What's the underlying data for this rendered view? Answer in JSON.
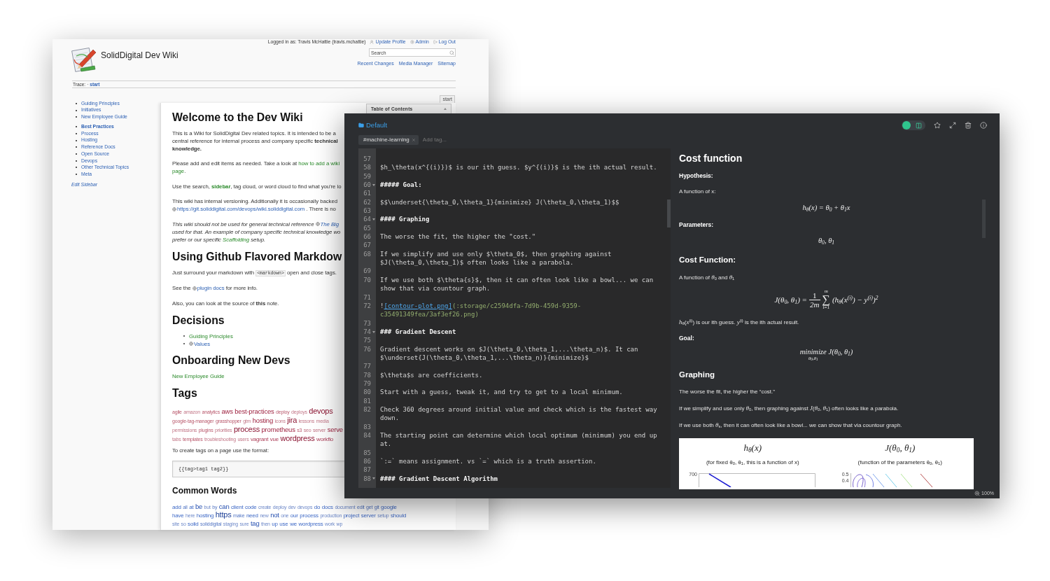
{
  "wiki": {
    "user_bar": {
      "text": "Logged in as: Travis McHattie (travis.mchattie)",
      "links": [
        {
          "kind": "profile",
          "label": "Update Profile"
        },
        {
          "kind": "admin",
          "label": "Admin"
        },
        {
          "kind": "logout",
          "label": "Log Out"
        }
      ]
    },
    "site_title": "SolidDigital Dev Wiki",
    "search": {
      "placeholder": "Search"
    },
    "nav_links": [
      "Recent Changes",
      "Media Manager",
      "Sitemap"
    ],
    "trace": {
      "label": "Trace:",
      "separator": "·",
      "page": "start"
    },
    "sidebar": {
      "groups": [
        [
          {
            "label": "Guiding Principles",
            "bold": false
          },
          {
            "label": "Initiatives",
            "bold": false
          },
          {
            "label": "New Employee Guide",
            "bold": false
          }
        ],
        [
          {
            "label": "Best Practices",
            "bold": true
          },
          {
            "label": "Process",
            "bold": false
          },
          {
            "label": "Hosting",
            "bold": false
          },
          {
            "label": "Reference Docs",
            "bold": false
          },
          {
            "label": "Open Source",
            "bold": false
          },
          {
            "label": "Devops",
            "bold": false
          },
          {
            "label": "Other Technical Topics",
            "bold": false
          },
          {
            "label": "Meta",
            "bold": false
          }
        ]
      ],
      "edit_link": "Edit Sidebar"
    },
    "page_tab": "start",
    "toc_title": "Table of Contents",
    "content": [
      {
        "kind": "h1",
        "text": "Welcome to the Dev Wiki"
      },
      {
        "kind": "paragraph",
        "lines": [
          [
            {
              "kind": "text",
              "text": "This is a Wiki for SolidDigital Dev related topics. It is intended to be a"
            }
          ],
          [
            {
              "kind": "text",
              "text": "central reference for internal process and company specific **technical**"
            }
          ],
          [
            {
              "kind": "text",
              "text": "**knowledge.**"
            }
          ]
        ]
      },
      {
        "kind": "paragraph",
        "lines": [
          [
            {
              "kind": "text",
              "text": "Please add and edit items as needed. Take a look at "
            },
            {
              "kind": "link",
              "text": "how to add a wiki"
            }
          ],
          [
            {
              "kind": "link",
              "text": "page"
            },
            {
              "kind": "text",
              "text": "."
            }
          ]
        ]
      },
      {
        "kind": "paragraph",
        "lines": [
          [
            {
              "kind": "text",
              "text": "Use the search, "
            },
            {
              "kind": "bold-link",
              "text": "sidebar"
            },
            {
              "kind": "text",
              "text": ", tag cloud, or word cloud to find what you're lo"
            }
          ]
        ]
      },
      {
        "kind": "paragraph",
        "lines": [
          [
            {
              "kind": "text",
              "text": "This wiki has internal versioning. Additionally it is occasionally backed"
            }
          ],
          [
            {
              "kind": "url",
              "text": "https://git.soliddigital.com/devops/wiki.soliddigital.com"
            },
            {
              "kind": "text",
              "text": " . There is no"
            }
          ]
        ]
      },
      {
        "kind": "note",
        "lines": [
          [
            {
              "kind": "text",
              "text": "This wiki should not be used for general technical reference "
            },
            {
              "kind": "url",
              "text": "The Big"
            }
          ],
          [
            {
              "kind": "text",
              "text": "used for that. An example of company specific technical knowledge wo"
            }
          ],
          [
            {
              "kind": "text",
              "text": "prefer or our specific "
            },
            {
              "kind": "link",
              "text": "Scaffolding"
            },
            {
              "kind": "text",
              "text": " setup."
            }
          ]
        ]
      },
      {
        "kind": "h2",
        "text": "Using Github Flavored Markdow"
      },
      {
        "kind": "paragraph",
        "lines": [
          [
            {
              "kind": "text",
              "text": "Just surround your markdown with "
            },
            {
              "kind": "code",
              "text": "<markdown>"
            },
            {
              "kind": "text",
              "text": " open and close tags."
            }
          ]
        ]
      },
      {
        "kind": "paragraph",
        "lines": [
          [
            {
              "kind": "text",
              "text": "See the "
            },
            {
              "kind": "url",
              "text": "plugin docs"
            },
            {
              "kind": "text",
              "text": " for more info."
            }
          ]
        ]
      },
      {
        "kind": "paragraph",
        "lines": [
          [
            {
              "kind": "text",
              "text": "Also, you can look at the source of **this** note."
            }
          ]
        ]
      },
      {
        "kind": "h2",
        "text": "Decisions"
      },
      {
        "kind": "list",
        "items": [
          [
            {
              "kind": "link",
              "text": "Guiding Principles"
            }
          ],
          [
            {
              "kind": "url",
              "text": "Values"
            }
          ]
        ]
      },
      {
        "kind": "h2",
        "text": "Onboarding New Devs"
      },
      {
        "kind": "paragraph",
        "lines": [
          [
            {
              "kind": "link",
              "text": "New Employee Guide"
            }
          ]
        ]
      },
      {
        "kind": "h2",
        "text": "Tags"
      },
      {
        "kind": "tag_cloud",
        "lines": [
          {
            "tags": [
              {
                "text": "agile",
                "kind": "uncommon"
              },
              {
                "text": "amazon",
                "kind": "rare"
              },
              {
                "text": "analytics",
                "kind": "uncommon"
              },
              {
                "text": "aws",
                "kind": "frequent"
              },
              {
                "text": "best-practices",
                "kind": "frequent"
              },
              {
                "text": "deploy",
                "kind": "uncommon"
              },
              {
                "text": "deploys",
                "kind": "rare"
              },
              {
                "text": "devops",
                "kind": "top"
              }
            ]
          },
          {
            "tags": [
              {
                "text": "google-tag-manager",
                "kind": "uncommon"
              },
              {
                "text": "grasshopper",
                "kind": "uncommon"
              },
              {
                "text": "gtm",
                "kind": "rare"
              },
              {
                "text": "hosting",
                "kind": "frequent"
              },
              {
                "text": "icons",
                "kind": "rare"
              },
              {
                "text": "jira",
                "kind": "top"
              },
              {
                "text": "lessons",
                "kind": "rare"
              },
              {
                "text": "media",
                "kind": "rare"
              }
            ]
          },
          {
            "tags": [
              {
                "text": "permissions",
                "kind": "rare"
              },
              {
                "text": "plugins",
                "kind": "uncommon"
              },
              {
                "text": "priorities",
                "kind": "rare"
              },
              {
                "text": "process",
                "kind": "top"
              },
              {
                "text": "prometheus",
                "kind": "frequent"
              },
              {
                "text": "s3",
                "kind": "uncommon"
              },
              {
                "text": "seo",
                "kind": "rare"
              },
              {
                "text": "server",
                "kind": "rare"
              },
              {
                "text": "serve",
                "kind": "frequent"
              }
            ]
          },
          {
            "tags": [
              {
                "text": "tabs",
                "kind": "rare"
              },
              {
                "text": "templates",
                "kind": "uncommon"
              },
              {
                "text": "troubleshooting",
                "kind": "rare"
              },
              {
                "text": "users",
                "kind": "rare"
              },
              {
                "text": "vagrant",
                "kind": "common"
              },
              {
                "text": "vue",
                "kind": "common"
              },
              {
                "text": "wordpress",
                "kind": "top"
              },
              {
                "text": "workflo",
                "kind": "common"
              }
            ]
          }
        ]
      },
      {
        "kind": "paragraph",
        "lines": [
          [
            {
              "kind": "text",
              "text": "To create tags on a page use the format:"
            }
          ]
        ]
      },
      {
        "kind": "code_block",
        "text": "{{tag>tag1 tag2}}"
      },
      {
        "kind": "h3",
        "text": "Common Words"
      },
      {
        "kind": "word_cloud",
        "lines": [
          {
            "tags": [
              {
                "text": "add",
                "kind": "common"
              },
              {
                "text": "all",
                "kind": "uncommon"
              },
              {
                "text": "at",
                "kind": "common"
              },
              {
                "text": "be",
                "kind": "frequent"
              },
              {
                "text": "but",
                "kind": "rare"
              },
              {
                "text": "by",
                "kind": "uncommon"
              },
              {
                "text": "can",
                "kind": "frequent"
              },
              {
                "text": "client",
                "kind": "common"
              },
              {
                "text": "code",
                "kind": "common"
              },
              {
                "text": "create",
                "kind": "rare"
              },
              {
                "text": "deploy",
                "kind": "rare"
              },
              {
                "text": "dev",
                "kind": "rare"
              },
              {
                "text": "devops",
                "kind": "rare"
              },
              {
                "text": "do",
                "kind": "common"
              },
              {
                "text": "docs",
                "kind": "common"
              },
              {
                "text": "document",
                "kind": "rare"
              },
              {
                "text": "edit",
                "kind": "uncommon"
              },
              {
                "text": "get",
                "kind": "uncommon"
              },
              {
                "text": "git",
                "kind": "uncommon"
              },
              {
                "text": "google",
                "kind": "common"
              }
            ]
          },
          {
            "tags": [
              {
                "text": "have",
                "kind": "common"
              },
              {
                "text": "here",
                "kind": "rare"
              },
              {
                "text": "hosting",
                "kind": "common"
              },
              {
                "text": "https",
                "kind": "top"
              },
              {
                "text": "make",
                "kind": "uncommon"
              },
              {
                "text": "need",
                "kind": "common"
              },
              {
                "text": "new",
                "kind": "rare"
              },
              {
                "text": "not",
                "kind": "frequent"
              },
              {
                "text": "one",
                "kind": "rare"
              },
              {
                "text": "our",
                "kind": "common"
              },
              {
                "text": "process",
                "kind": "common"
              },
              {
                "text": "production",
                "kind": "rare"
              },
              {
                "text": "project",
                "kind": "common"
              },
              {
                "text": "server",
                "kind": "common"
              },
              {
                "text": "setup",
                "kind": "rare"
              },
              {
                "text": "should",
                "kind": "common"
              }
            ]
          },
          {
            "tags": [
              {
                "text": "site",
                "kind": "rare"
              },
              {
                "text": "so",
                "kind": "rare"
              },
              {
                "text": "solid",
                "kind": "common"
              },
              {
                "text": "soliddigital",
                "kind": "uncommon"
              },
              {
                "text": "staging",
                "kind": "rare"
              },
              {
                "text": "sure",
                "kind": "rare"
              },
              {
                "text": "tag",
                "kind": "frequent"
              },
              {
                "text": "then",
                "kind": "rare"
              },
              {
                "text": "up",
                "kind": "common"
              },
              {
                "text": "use",
                "kind": "common"
              },
              {
                "text": "we",
                "kind": "common"
              },
              {
                "text": "wordpress",
                "kind": "common"
              },
              {
                "text": "work",
                "kind": "rare"
              },
              {
                "text": "wp",
                "kind": "rare"
              }
            ]
          }
        ]
      }
    ]
  },
  "editor": {
    "folder": "Default",
    "tags": [
      "#machine-learning"
    ],
    "tag_input": {
      "placeholder": "Add tag..."
    },
    "mode_toggle": {
      "on": false
    },
    "lines": [
      {
        "number": "57",
        "foldable": false
      },
      {
        "number": "58",
        "foldable": false,
        "segments": [
          {
            "kind": "plain",
            "text": "$h_\\theta(x^{(i)})$ is our ith guess. $y^{(i)}$ is the ith actual result."
          }
        ]
      },
      {
        "number": "59",
        "foldable": false
      },
      {
        "number": "60",
        "foldable": true,
        "segments": [
          {
            "kind": "heading",
            "text": "##### Goal:"
          }
        ]
      },
      {
        "number": "61",
        "foldable": false
      },
      {
        "number": "62",
        "foldable": false,
        "segments": [
          {
            "kind": "plain",
            "text": "$$\\underset{\\theta_0,\\theta_1}{minimize} J(\\theta_0,\\theta_1)$$"
          }
        ]
      },
      {
        "number": "63",
        "foldable": false
      },
      {
        "number": "64",
        "foldable": true,
        "segments": [
          {
            "kind": "heading",
            "text": "#### Graphing"
          }
        ]
      },
      {
        "number": "65",
        "foldable": false
      },
      {
        "number": "66",
        "foldable": false,
        "segments": [
          {
            "kind": "plain",
            "text": "The worse the fit, the higher the \"cost.\""
          }
        ]
      },
      {
        "number": "67",
        "foldable": false
      },
      {
        "number": "68",
        "foldable": false,
        "segments": [
          {
            "kind": "plain",
            "text": "If we simplify and use only $\\theta_0$, then graphing against $J(\\theta_0,\\theta_1)$ often looks like a parabola."
          }
        ]
      },
      {
        "number": "69",
        "foldable": false
      },
      {
        "number": "70",
        "foldable": false,
        "segments": [
          {
            "kind": "plain",
            "text": "If we use both $\\theta{s}$, then it can often look like a bowl... we can show that via countour graph."
          }
        ]
      },
      {
        "number": "71",
        "foldable": false
      },
      {
        "number": "72",
        "foldable": false,
        "segments": [
          {
            "kind": "plain",
            "text": "!"
          },
          {
            "kind": "link",
            "text": "[contour-plot.png]"
          },
          {
            "kind": "path",
            "text": "(:storage/c2594dfa-7d9b-459d-9359-c35491349fea/3af3ef26.png)"
          }
        ]
      },
      {
        "number": "73",
        "foldable": false
      },
      {
        "number": "74",
        "foldable": true,
        "segments": [
          {
            "kind": "heading",
            "text": "### Gradient Descent"
          }
        ]
      },
      {
        "number": "75",
        "foldable": false
      },
      {
        "number": "76",
        "foldable": false,
        "segments": [
          {
            "kind": "plain",
            "text": "Gradient descent works on $J(\\theta_0,\\theta_1,...\\theta_n)$. It can $\\underset{J(\\theta_0,\\theta_1,...\\theta_n)}{minimize}$"
          }
        ]
      },
      {
        "number": "77",
        "foldable": false
      },
      {
        "number": "78",
        "foldable": false,
        "segments": [
          {
            "kind": "plain",
            "text": "$\\theta$s are coefficients."
          }
        ]
      },
      {
        "number": "79",
        "foldable": false
      },
      {
        "number": "80",
        "foldable": false,
        "segments": [
          {
            "kind": "plain",
            "text": "Start with a guess, tweak it, and try to get to a local minimum."
          }
        ]
      },
      {
        "number": "81",
        "foldable": false
      },
      {
        "number": "82",
        "foldable": false,
        "segments": [
          {
            "kind": "plain",
            "text": "Check 360 degrees around initial value and check which is the fastest way down."
          }
        ]
      },
      {
        "number": "83",
        "foldable": false
      },
      {
        "number": "84",
        "foldable": false,
        "segments": [
          {
            "kind": "plain",
            "text": "The starting point can determine which local optimum (minimum) you end up at."
          }
        ]
      },
      {
        "number": "85",
        "foldable": false
      },
      {
        "number": "86",
        "foldable": false,
        "segments": [
          {
            "kind": "plain",
            "text": "`:=` means assignment. vs `=` which is a truth assertion."
          }
        ]
      },
      {
        "number": "87",
        "foldable": false
      },
      {
        "number": "88",
        "foldable": true,
        "segments": [
          {
            "kind": "heading",
            "text": "#### Gradient Descent Algorithm"
          }
        ]
      }
    ],
    "preview": [
      {
        "kind": "h1",
        "text": "Cost function"
      },
      {
        "kind": "label",
        "text": "Hypothesis:"
      },
      {
        "kind": "paragraph",
        "text": "A function of x:"
      },
      {
        "kind": "math",
        "text": "h$_{θ}$(x) = θ$_{0}$ + θ$_{1}$x"
      },
      {
        "kind": "label",
        "text": "Parameters:"
      },
      {
        "kind": "math",
        "text": "θ$_{0}$, θ$_{1}$"
      },
      {
        "kind": "h2",
        "text": "Cost Function:"
      },
      {
        "kind": "paragraph",
        "text": "A function of *θ*$_{0}$ and *θ*$_{1}$"
      },
      {
        "kind": "sum_formula",
        "lhs": "J(θ$_{0}$, θ$_{1}$) =",
        "numerator": "1",
        "denominator": "2m",
        "operator": "∑",
        "upper": "m",
        "lower": "i=1",
        "body": "(h$_{θ}$(x$^{(i)}$) − y$^{(i)}$)$^{2}$"
      },
      {
        "kind": "paragraph",
        "text": "*h*$_{θ}$(*x*$^{(i)}$) is our ith guess. *y*$^{(i)}$ is the ith actual result."
      },
      {
        "kind": "label",
        "text": "Goal:"
      },
      {
        "kind": "underset_formula",
        "operator": "minimize",
        "under": "θ$_{0}$,θ$_{1}$",
        "body": "J(θ$_{0}$, θ$_{1}$)"
      },
      {
        "kind": "h2",
        "text": "Graphing"
      },
      {
        "kind": "paragraph",
        "text": "The worse the fit, the higher the “cost.”"
      },
      {
        "kind": "paragraph",
        "text": "If we simplify and use only *θ*$_{0}$, then graphing against *J*(*θ*$_{0}$, *θ*$_{1}$) often looks like a parabola."
      },
      {
        "kind": "paragraph",
        "text": "If we use both *θ*$_{s}$, then it can often look like a bowl... we can show that via countour graph."
      },
      {
        "kind": "figure",
        "panels": [
          {
            "kind": "line",
            "title": "h$_{θ}$(x)",
            "caption": "(for fixed θ$_{0}$, θ$_{1}$, this is a function of x)",
            "ticks": [
              "700"
            ]
          },
          {
            "kind": "contour",
            "title": "J(θ$_{0}$, θ$_{1}$)",
            "caption": "(function of the parameters θ$_{0}$, θ$_{1}$)",
            "ticks": [
              "0.5",
              "0.4"
            ]
          }
        ]
      }
    ],
    "zoom": "100%"
  }
}
